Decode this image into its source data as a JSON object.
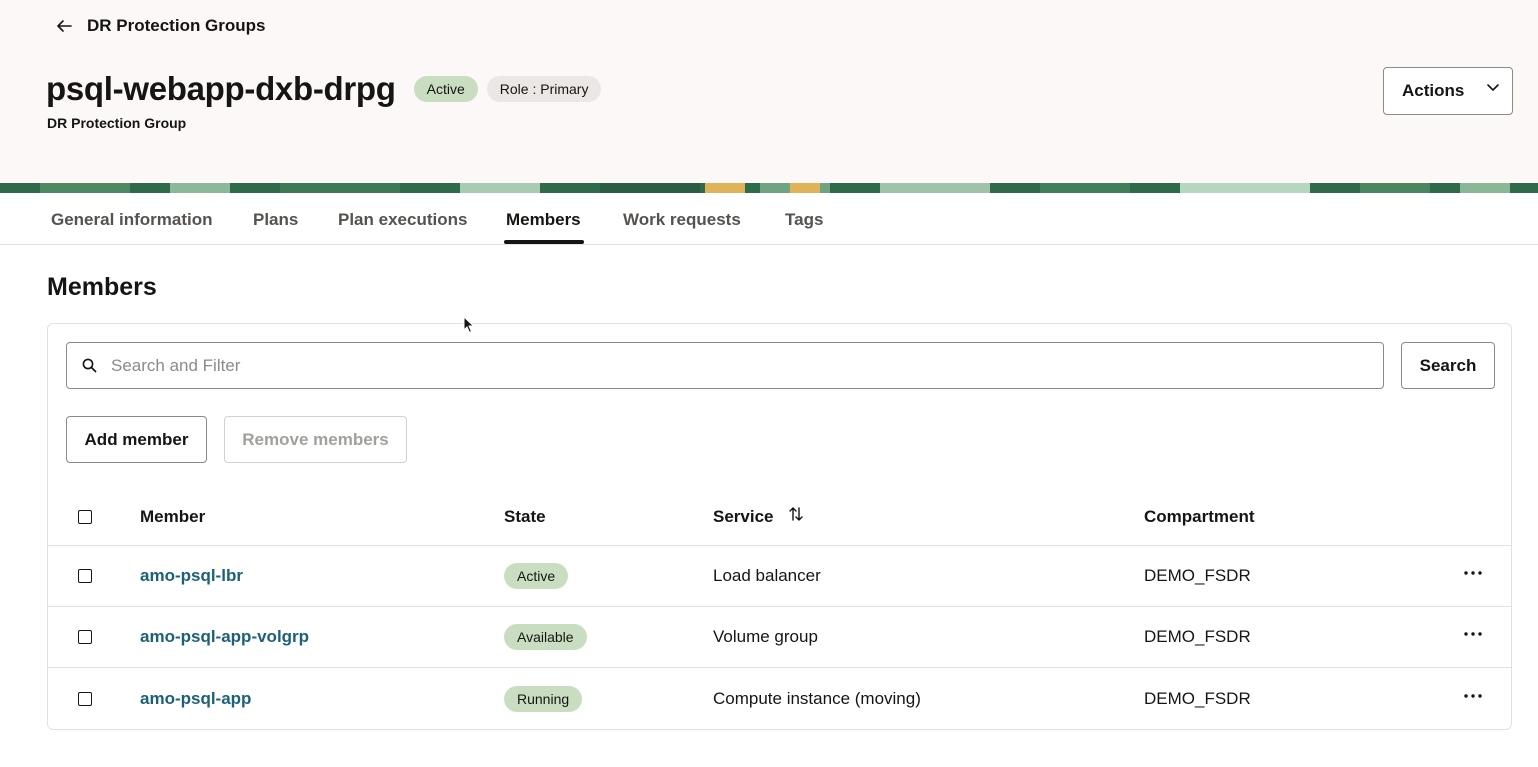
{
  "header": {
    "back_label": "DR Protection Groups",
    "title": "psql-webapp-dxb-drpg",
    "status_badge": "Active",
    "role_badge": "Role : Primary",
    "subtitle": "DR Protection Group",
    "actions_label": "Actions"
  },
  "tabs": [
    {
      "label": "General information"
    },
    {
      "label": "Plans"
    },
    {
      "label": "Plan executions"
    },
    {
      "label": "Members",
      "active": true
    },
    {
      "label": "Work requests"
    },
    {
      "label": "Tags"
    }
  ],
  "members": {
    "section_title": "Members",
    "search": {
      "placeholder": "Search and Filter",
      "value": "",
      "button_label": "Search"
    },
    "add_label": "Add member",
    "remove_label": "Remove members",
    "columns": {
      "member": "Member",
      "state": "State",
      "service": "Service",
      "compartment": "Compartment"
    },
    "rows": [
      {
        "member": "amo-psql-lbr",
        "state": "Active",
        "service": "Load balancer",
        "compartment": "DEMO_FSDR"
      },
      {
        "member": "amo-psql-app-volgrp",
        "state": "Available",
        "service": "Volume group",
        "compartment": "DEMO_FSDR"
      },
      {
        "member": "amo-psql-app",
        "state": "Running",
        "service": "Compute instance (moving)",
        "compartment": "DEMO_FSDR"
      }
    ]
  },
  "colors": {
    "accent_link": "#1d6178",
    "status_green": "#c9dec0",
    "header_bg": "#fbf8f7"
  },
  "icons": [
    "back-arrow-icon",
    "chevron-down-icon",
    "search-icon",
    "sort-icon",
    "more-options-icon",
    "mouse-cursor-icon"
  ]
}
